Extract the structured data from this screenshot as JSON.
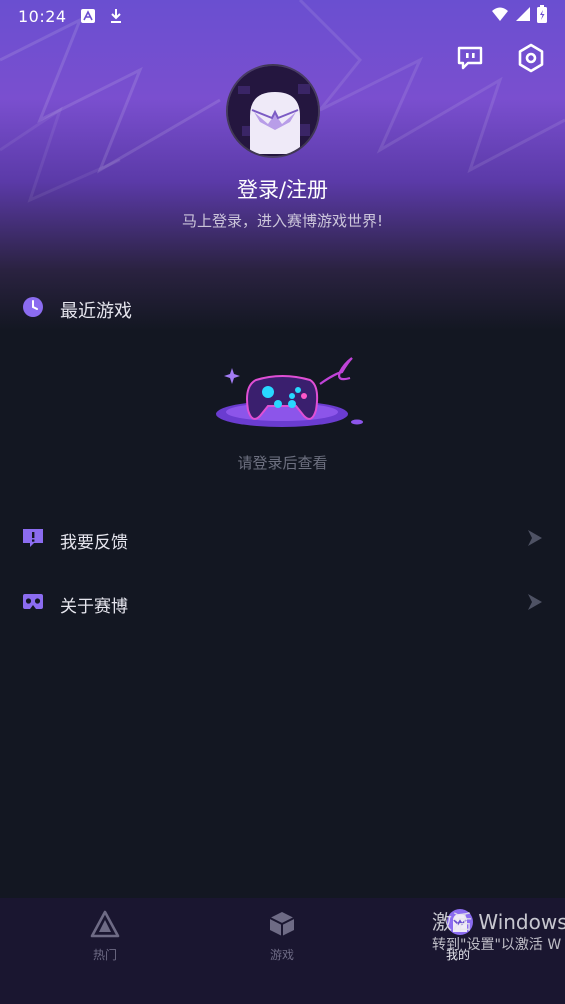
{
  "status_bar": {
    "time": "10:24",
    "icons": [
      "a-icon",
      "download-icon",
      "wifi-icon",
      "signal-icon",
      "battery-icon"
    ]
  },
  "header": {
    "icons": [
      "feedback-chat-icon",
      "settings-hex-icon"
    ]
  },
  "profile": {
    "title": "登录/注册",
    "subtitle": "马上登录，进入赛博游戏世界!"
  },
  "recent": {
    "label": "最近游戏",
    "empty_text": "请登录后查看"
  },
  "menu": [
    {
      "label": "我要反馈",
      "icon": "feedback-icon"
    },
    {
      "label": "关于赛博",
      "icon": "vr-icon"
    }
  ],
  "bottom_nav": [
    {
      "label": "热门",
      "icon": "triangle-logo-icon"
    },
    {
      "label": "游戏",
      "icon": "cube-icon"
    },
    {
      "label": "我的",
      "icon": "ghost-avatar-icon"
    }
  ],
  "watermark": {
    "line1": "激活 Windows",
    "line2": "转到\"设置\"以激活 W"
  },
  "colors": {
    "accent": "#8b6cf0",
    "background": "#131722",
    "nav_bg": "#1a1630"
  }
}
